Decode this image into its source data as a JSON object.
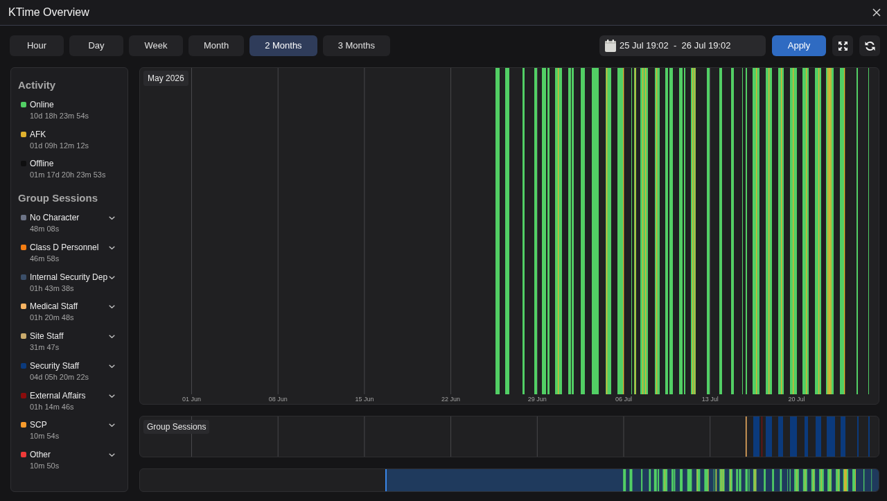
{
  "window": {
    "title": "KTime Overview"
  },
  "range_tabs": [
    {
      "label": "Hour",
      "selected": false
    },
    {
      "label": "Day",
      "selected": false
    },
    {
      "label": "Week",
      "selected": false
    },
    {
      "label": "Month",
      "selected": false
    },
    {
      "label": "2 Months",
      "selected": true
    },
    {
      "label": "3 Months",
      "selected": false
    }
  ],
  "date_range": {
    "value": "25 Jul 19:02  -  26 Jul 19:02"
  },
  "apply_button": {
    "label": "Apply"
  },
  "sidebar": {
    "activity": {
      "title": "Activity",
      "items": [
        {
          "label": "Online",
          "duration": "10d 18h 23m 54s",
          "color": "#52cf65"
        },
        {
          "label": "AFK",
          "duration": "01d 09h 12m 12s",
          "color": "#e0b12e"
        },
        {
          "label": "Offline",
          "duration": "01m 17d 20h 23m 53s",
          "color": "#0f0f10"
        }
      ]
    },
    "group_sessions": {
      "title": "Group Sessions",
      "items": [
        {
          "label": "No Character",
          "duration": "48m 08s",
          "color": "#6c7386"
        },
        {
          "label": "Class D Personnel",
          "duration": "46m 58s",
          "color": "#f47d12"
        },
        {
          "label": "Internal Security Dep",
          "duration": "01h 43m 38s",
          "color": "#3b4e68"
        },
        {
          "label": "Medical Staff",
          "duration": "01h 20m 48s",
          "color": "#f6b362"
        },
        {
          "label": "Site Staff",
          "duration": "31m 47s",
          "color": "#c9aa6c"
        },
        {
          "label": "Security Staff",
          "duration": "04d 05h 20m 22s",
          "color": "#0b3a7c"
        },
        {
          "label": "External Affairs",
          "duration": "01h 14m 46s",
          "color": "#8a0c0c"
        },
        {
          "label": "SCP",
          "duration": "10m 54s",
          "color": "#f89b2c"
        },
        {
          "label": "Other",
          "duration": "10m 50s",
          "color": "#ef3a38"
        }
      ]
    }
  },
  "timeline": {
    "period_label": "May 2026",
    "axis_labels": [
      "01 Jun",
      "08 Jun",
      "15 Jun",
      "22 Jun",
      "29 Jun",
      "06 Jul",
      "13 Jul",
      "20 Jul"
    ]
  },
  "group_timeline": {
    "label": "Group Sessions"
  }
}
